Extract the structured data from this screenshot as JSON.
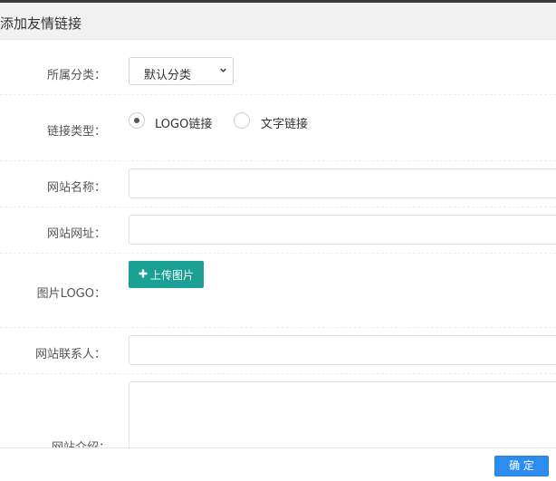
{
  "dialog": {
    "title": "添加友情链接"
  },
  "form": {
    "category": {
      "label": "所属分类：",
      "value": "默认分类"
    },
    "link_type": {
      "label": "链接类型：",
      "options": [
        {
          "label": "LOGO链接",
          "selected": true
        },
        {
          "label": "文字链接",
          "selected": false
        }
      ]
    },
    "site_name": {
      "label": "网站名称：",
      "value": ""
    },
    "site_url": {
      "label": "网站网址：",
      "value": ""
    },
    "logo": {
      "label": "图片LOGO：",
      "upload_label": "上传图片"
    },
    "contact": {
      "label": "网站联系人：",
      "value": ""
    },
    "intro": {
      "label": "网站介绍：",
      "value": ""
    }
  },
  "footer": {
    "confirm_label": "确 定"
  },
  "colors": {
    "upload_button": "#1aa094",
    "confirm_button": "#2d8cf0"
  },
  "icons": {
    "select_arrow": "chevron-down-icon",
    "upload": "plus-icon"
  }
}
